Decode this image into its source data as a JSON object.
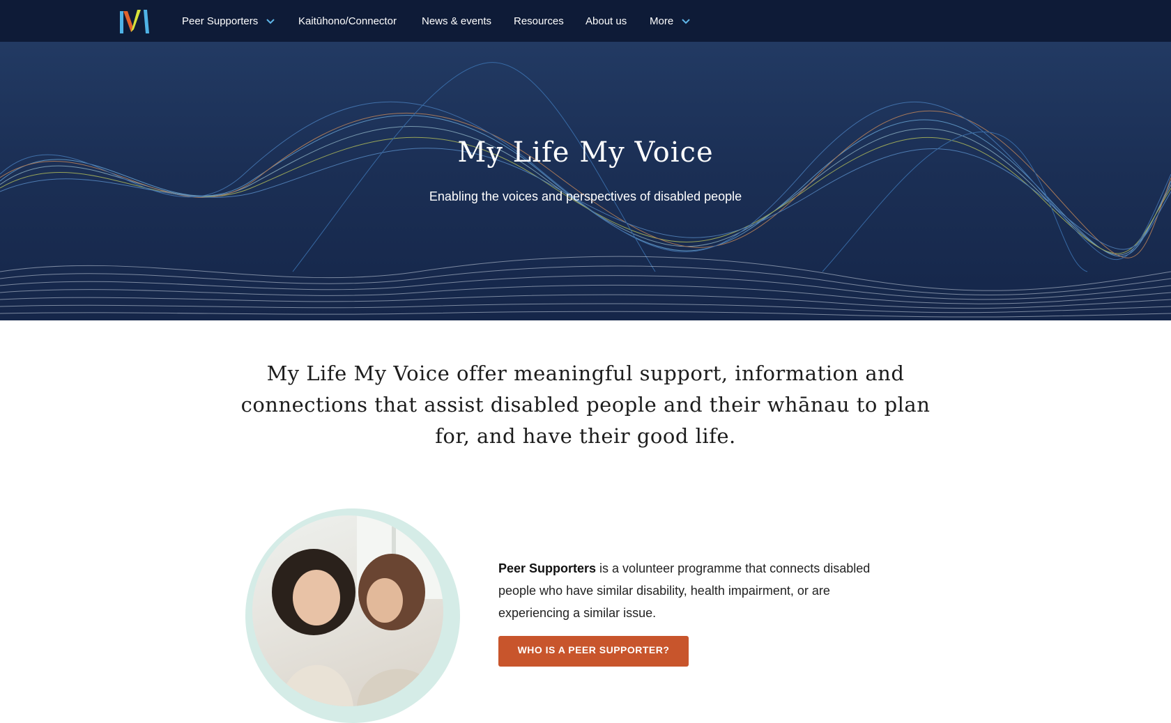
{
  "nav": {
    "logo_alt": "My Life My Voice logo",
    "items": [
      {
        "label": "Peer Supporters",
        "has_dropdown": true
      },
      {
        "label": "Kaitūhono/Connector",
        "has_dropdown": false
      },
      {
        "label": "News & events",
        "has_dropdown": false
      },
      {
        "label": "Resources",
        "has_dropdown": false
      },
      {
        "label": "About us",
        "has_dropdown": false
      },
      {
        "label": "More",
        "has_dropdown": true
      }
    ]
  },
  "hero": {
    "title": "My Life My Voice",
    "subtitle": "Enabling the voices and perspectives of disabled people"
  },
  "intro": {
    "text": "My Life My Voice offer meaningful support, information and connections that assist disabled people and their whānau to plan for, and have their good life."
  },
  "feature": {
    "bold_lead": "Peer Supporters",
    "body": " is a volunteer programme that connects disabled people who have similar disability, health impairment, or are experiencing a similar issue.",
    "cta_label": "WHO IS A PEER SUPPORTER?"
  },
  "colors": {
    "nav_bg": "#0e1b37",
    "hero_bg": "#1b2f55",
    "cta": "#c8552c",
    "circle_ring": "#d5ece7"
  }
}
